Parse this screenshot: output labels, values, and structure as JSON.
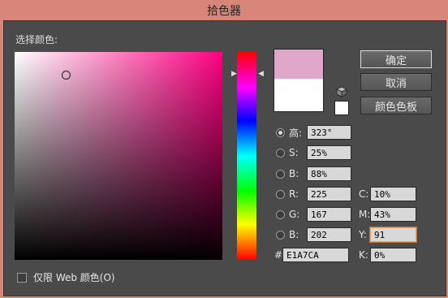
{
  "window": {
    "title": "拾色器"
  },
  "picker": {
    "label": "选择颜色:"
  },
  "buttons": {
    "ok": "确定",
    "cancel": "取消",
    "swatches": "颜色色板"
  },
  "colors": {
    "new": "#e1a7ca",
    "old": "#ffffff"
  },
  "hsb": [
    {
      "label": "高:",
      "value": "323°",
      "selected": true
    },
    {
      "label": "S:",
      "value": "25%",
      "selected": false
    },
    {
      "label": "B:",
      "value": "88%",
      "selected": false
    }
  ],
  "rgb": [
    {
      "label": "R:",
      "value": "225"
    },
    {
      "label": "G:",
      "value": "167"
    },
    {
      "label": "B:",
      "value": "202"
    }
  ],
  "cmyk": [
    {
      "label": "C:",
      "value": "10%"
    },
    {
      "label": "M:",
      "value": "43%"
    },
    {
      "label": "Y:",
      "value": "91"
    },
    {
      "label": "K:",
      "value": "0%"
    }
  ],
  "hex": {
    "label": "#",
    "value": "E1A7CA"
  },
  "websafe": {
    "label": "仅限 Web 颜色(O)"
  },
  "icons": {
    "cube": "cube-icon",
    "hue_arrow": "triangle-icon"
  }
}
